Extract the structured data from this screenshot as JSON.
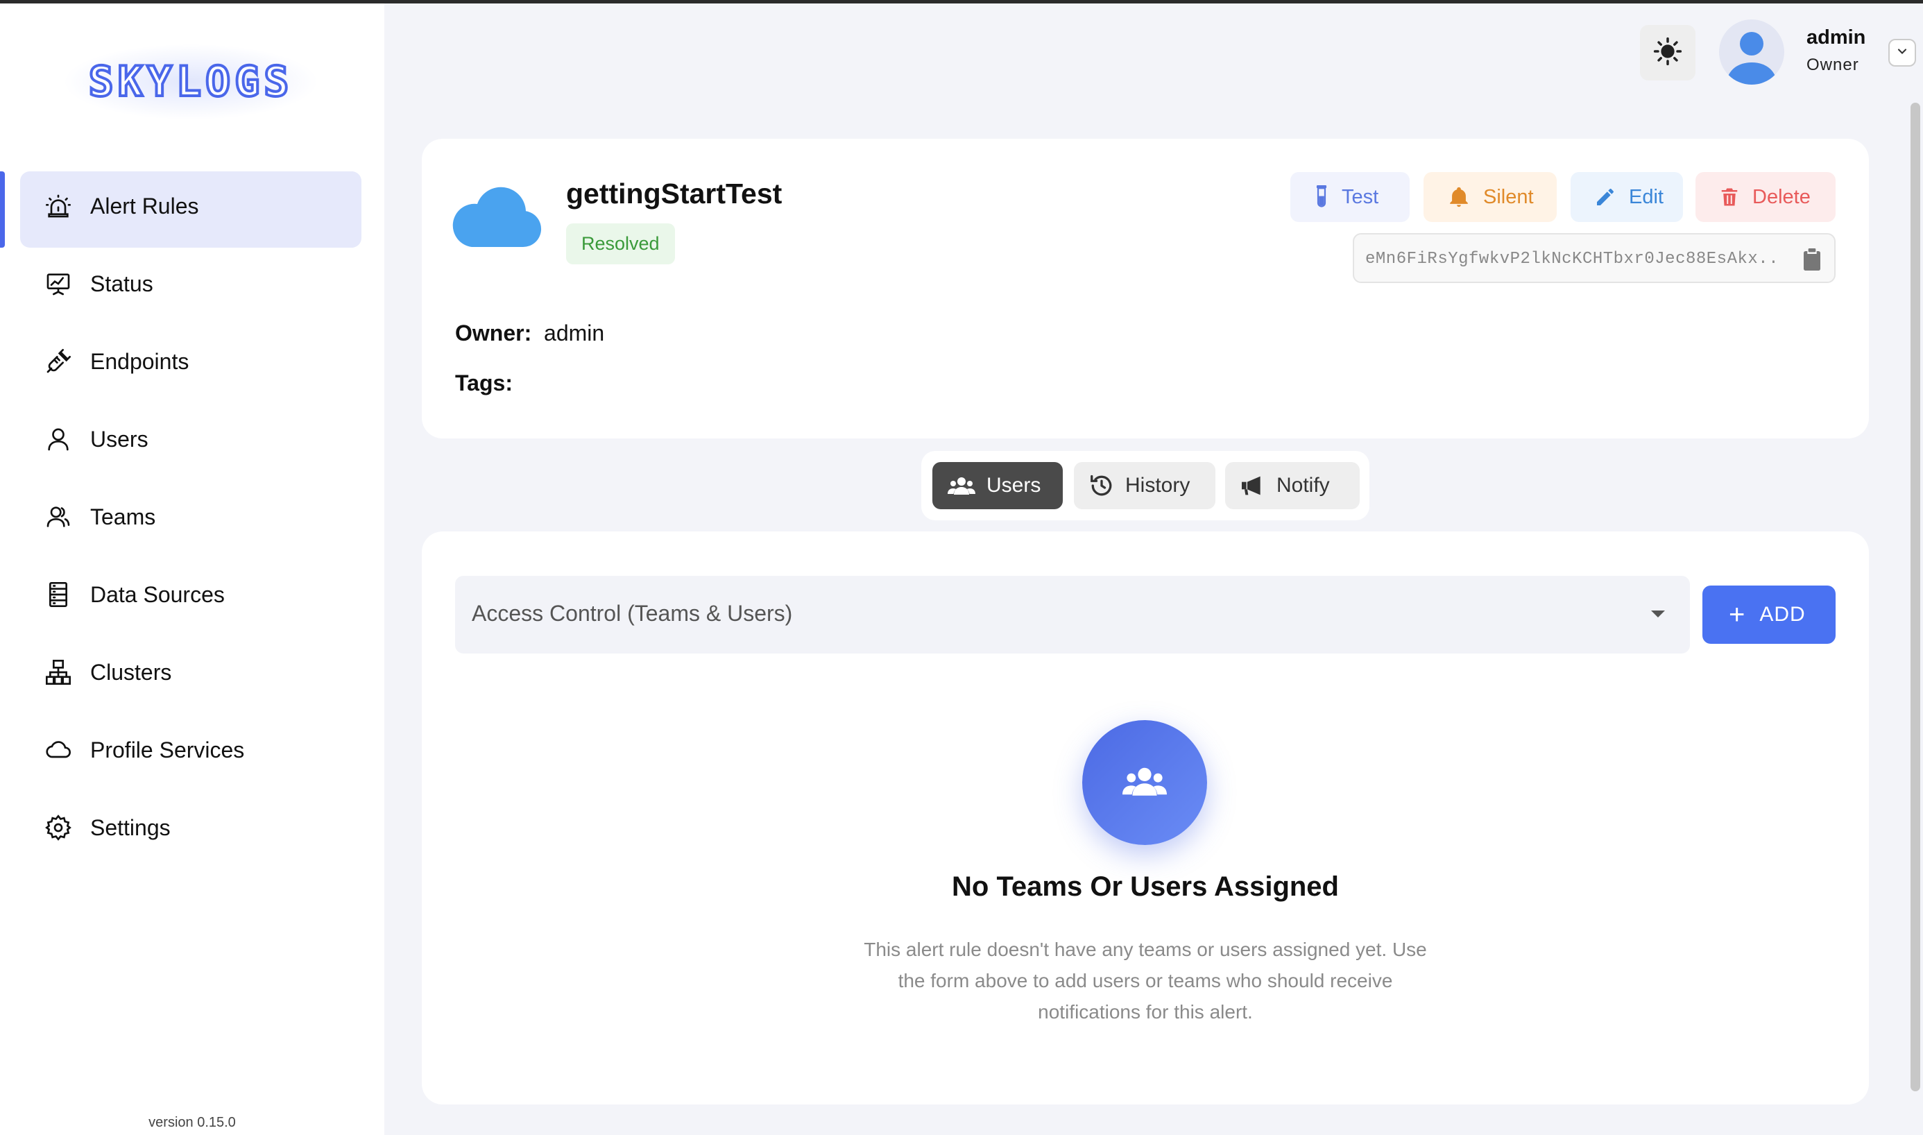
{
  "brand": {
    "logo_text": "SKYLOGS",
    "version": "version 0.15.0"
  },
  "sidebar": {
    "items": [
      {
        "label": "Alert Rules",
        "icon": "alarm-icon",
        "active": true
      },
      {
        "label": "Status",
        "icon": "presentation-chart-icon",
        "active": false
      },
      {
        "label": "Endpoints",
        "icon": "plug-icon",
        "active": false
      },
      {
        "label": "Users",
        "icon": "user-icon",
        "active": false
      },
      {
        "label": "Teams",
        "icon": "team-icon",
        "active": false
      },
      {
        "label": "Data Sources",
        "icon": "database-icon",
        "active": false
      },
      {
        "label": "Clusters",
        "icon": "sitemap-icon",
        "active": false
      },
      {
        "label": "Profile Services",
        "icon": "cloud-icon",
        "active": false
      },
      {
        "label": "Settings",
        "icon": "gear-icon",
        "active": false
      }
    ]
  },
  "header": {
    "user_name": "admin",
    "user_role": "Owner",
    "theme_icon": "sun-icon"
  },
  "rule": {
    "title": "gettingStartTest",
    "status": "Resolved",
    "owner_label": "Owner:",
    "owner_value": "admin",
    "tags_label": "Tags:",
    "token": "eMn6FiRsYgfwkvP2lkNcKCHTbxr0Jec88EsAkx..."
  },
  "actions": {
    "test": "Test",
    "silent": "Silent",
    "edit": "Edit",
    "delete": "Delete"
  },
  "tabs": {
    "users": "Users",
    "history": "History",
    "notify": "Notify",
    "active": "users"
  },
  "access": {
    "select_label": "Access Control (Teams & Users)",
    "add_label": "ADD",
    "empty_title": "No Teams Or Users Assigned",
    "empty_desc": "This alert rule doesn't have any teams or users assigned yet. Use the form above to add users or teams who should receive notifications for this alert."
  },
  "colors": {
    "accent": "#4a72f2",
    "active_nav_bg": "#e6e9fb",
    "resolved": "#3a9a3a"
  }
}
